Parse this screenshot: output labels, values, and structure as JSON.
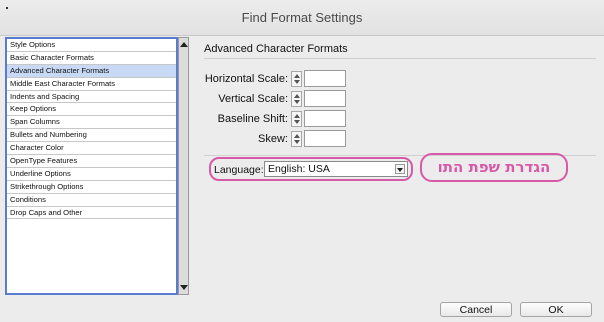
{
  "window": {
    "title": "Find Format Settings"
  },
  "sidebar": {
    "items": [
      {
        "label": "Style Options",
        "selected": false
      },
      {
        "label": "Basic Character Formats",
        "selected": false
      },
      {
        "label": "Advanced Character Formats",
        "selected": true
      },
      {
        "label": "Middle East Character Formats",
        "selected": false
      },
      {
        "label": "Indents and Spacing",
        "selected": false
      },
      {
        "label": "Keep Options",
        "selected": false
      },
      {
        "label": "Span Columns",
        "selected": false
      },
      {
        "label": "Bullets and Numbering",
        "selected": false
      },
      {
        "label": "Character Color",
        "selected": false
      },
      {
        "label": "OpenType Features",
        "selected": false
      },
      {
        "label": "Underline Options",
        "selected": false
      },
      {
        "label": "Strikethrough Options",
        "selected": false
      },
      {
        "label": "Conditions",
        "selected": false
      },
      {
        "label": "Drop Caps and Other",
        "selected": false
      }
    ]
  },
  "main": {
    "section_title": "Advanced Character Formats",
    "fields": [
      {
        "label": "Horizontal Scale:",
        "value": ""
      },
      {
        "label": "Vertical Scale:",
        "value": ""
      },
      {
        "label": "Baseline Shift:",
        "value": ""
      },
      {
        "label": "Skew:",
        "value": ""
      }
    ],
    "language": {
      "label": "Language:",
      "value": "English: USA"
    },
    "annotation": "הגדרת שפת התו"
  },
  "buttons": {
    "cancel": "Cancel",
    "ok": "OK"
  },
  "colors": {
    "selection": "#c7d9f5",
    "list_border": "#5a7bd0",
    "annotation": "#d65aa8"
  }
}
